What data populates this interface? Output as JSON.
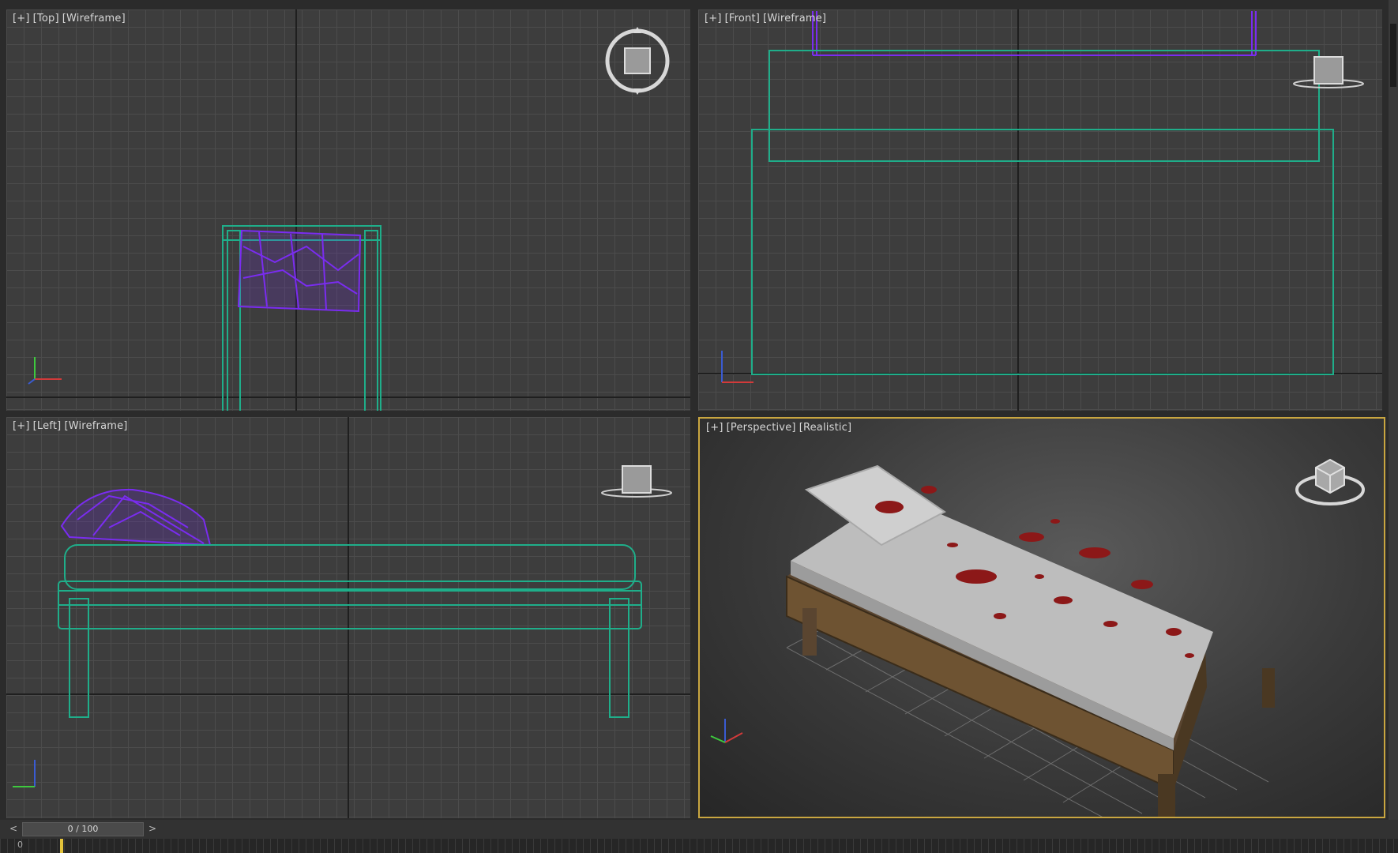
{
  "viewports": {
    "top": {
      "labels": [
        "[+]",
        "[Top]",
        "[Wireframe]"
      ]
    },
    "front": {
      "labels": [
        "[+]",
        "[Front]",
        "[Wireframe]"
      ]
    },
    "left": {
      "labels": [
        "[+]",
        "[Left]",
        "[Wireframe]"
      ]
    },
    "perspective": {
      "labels": [
        "[+]",
        "[Perspective]",
        "[Realistic]"
      ],
      "active_border_color": "#c9a640"
    }
  },
  "timeline": {
    "frame_display": "0 / 100",
    "prev_label": "<",
    "next_label": ">",
    "track_start_label": "0"
  },
  "colors": {
    "bed_frame_wire": "#1fae8a",
    "pillow_wire": "#7a2cf0",
    "viewport_bg": "#3d3d3d",
    "grid_line": "#4c4c4c"
  },
  "icons": {
    "viewcube": "viewcube-icon",
    "axis_tripod": "axis-tripod-icon"
  }
}
